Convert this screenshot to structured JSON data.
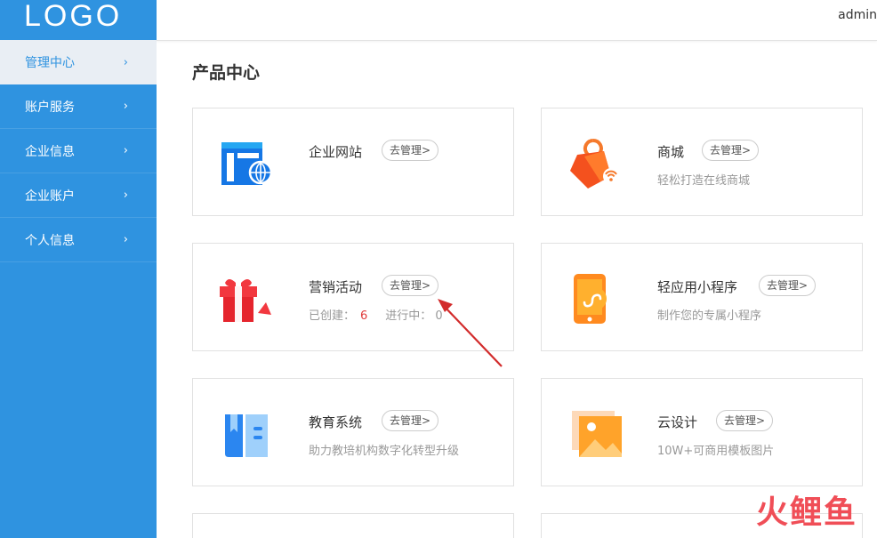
{
  "logo": "LOGO",
  "user": "admin",
  "sidebar": {
    "items": [
      {
        "label": "管理中心",
        "chevron": "›"
      },
      {
        "label": "账户服务",
        "chevron": "›"
      },
      {
        "label": "企业信息",
        "chevron": "›"
      },
      {
        "label": "企业账户",
        "chevron": "›"
      },
      {
        "label": "个人信息",
        "chevron": "›"
      }
    ]
  },
  "main": {
    "title": "产品中心",
    "manage_label": "去管理>",
    "cards": [
      {
        "name": "企业网站",
        "desc": ""
      },
      {
        "name": "商城",
        "desc": "轻松打造在线商城"
      },
      {
        "name": "营销活动",
        "created_label": "已创建：",
        "created": "6",
        "running_label": "进行中：",
        "running": "0"
      },
      {
        "name": "轻应用小程序",
        "desc": "制作您的专属小程序"
      },
      {
        "name": "教育系统",
        "desc": "助力教培机构数字化转型升级"
      },
      {
        "name": "云设计",
        "desc": "10W+可商用模板图片"
      }
    ]
  },
  "watermark": "火鲤鱼",
  "colors": {
    "sidebar": "#2f93e0",
    "accent_red": "#e03a3a",
    "arrow": "#d22b2b"
  }
}
